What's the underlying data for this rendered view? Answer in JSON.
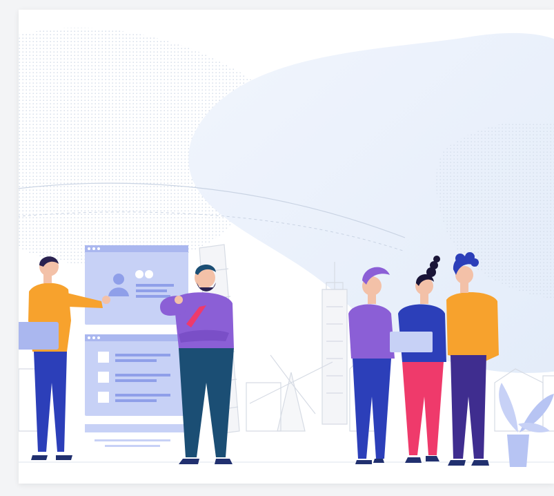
{
  "illustration": {
    "subject": "team-collaboration",
    "colors": {
      "blob": "#e8f0fb",
      "dots": "#cfd8e6",
      "ui_panel": "#c7d1f6",
      "ui_accent": "#8f9fe9",
      "orange": "#f7a22d",
      "purple": "#8b5fd6",
      "blue": "#2c3fb9",
      "navy": "#21306f",
      "pink": "#ef3a6b",
      "teal": "#1b4e74",
      "skin": "#f3c1a8",
      "hair": "#2a2250",
      "plant": "#b7c4f3"
    }
  }
}
